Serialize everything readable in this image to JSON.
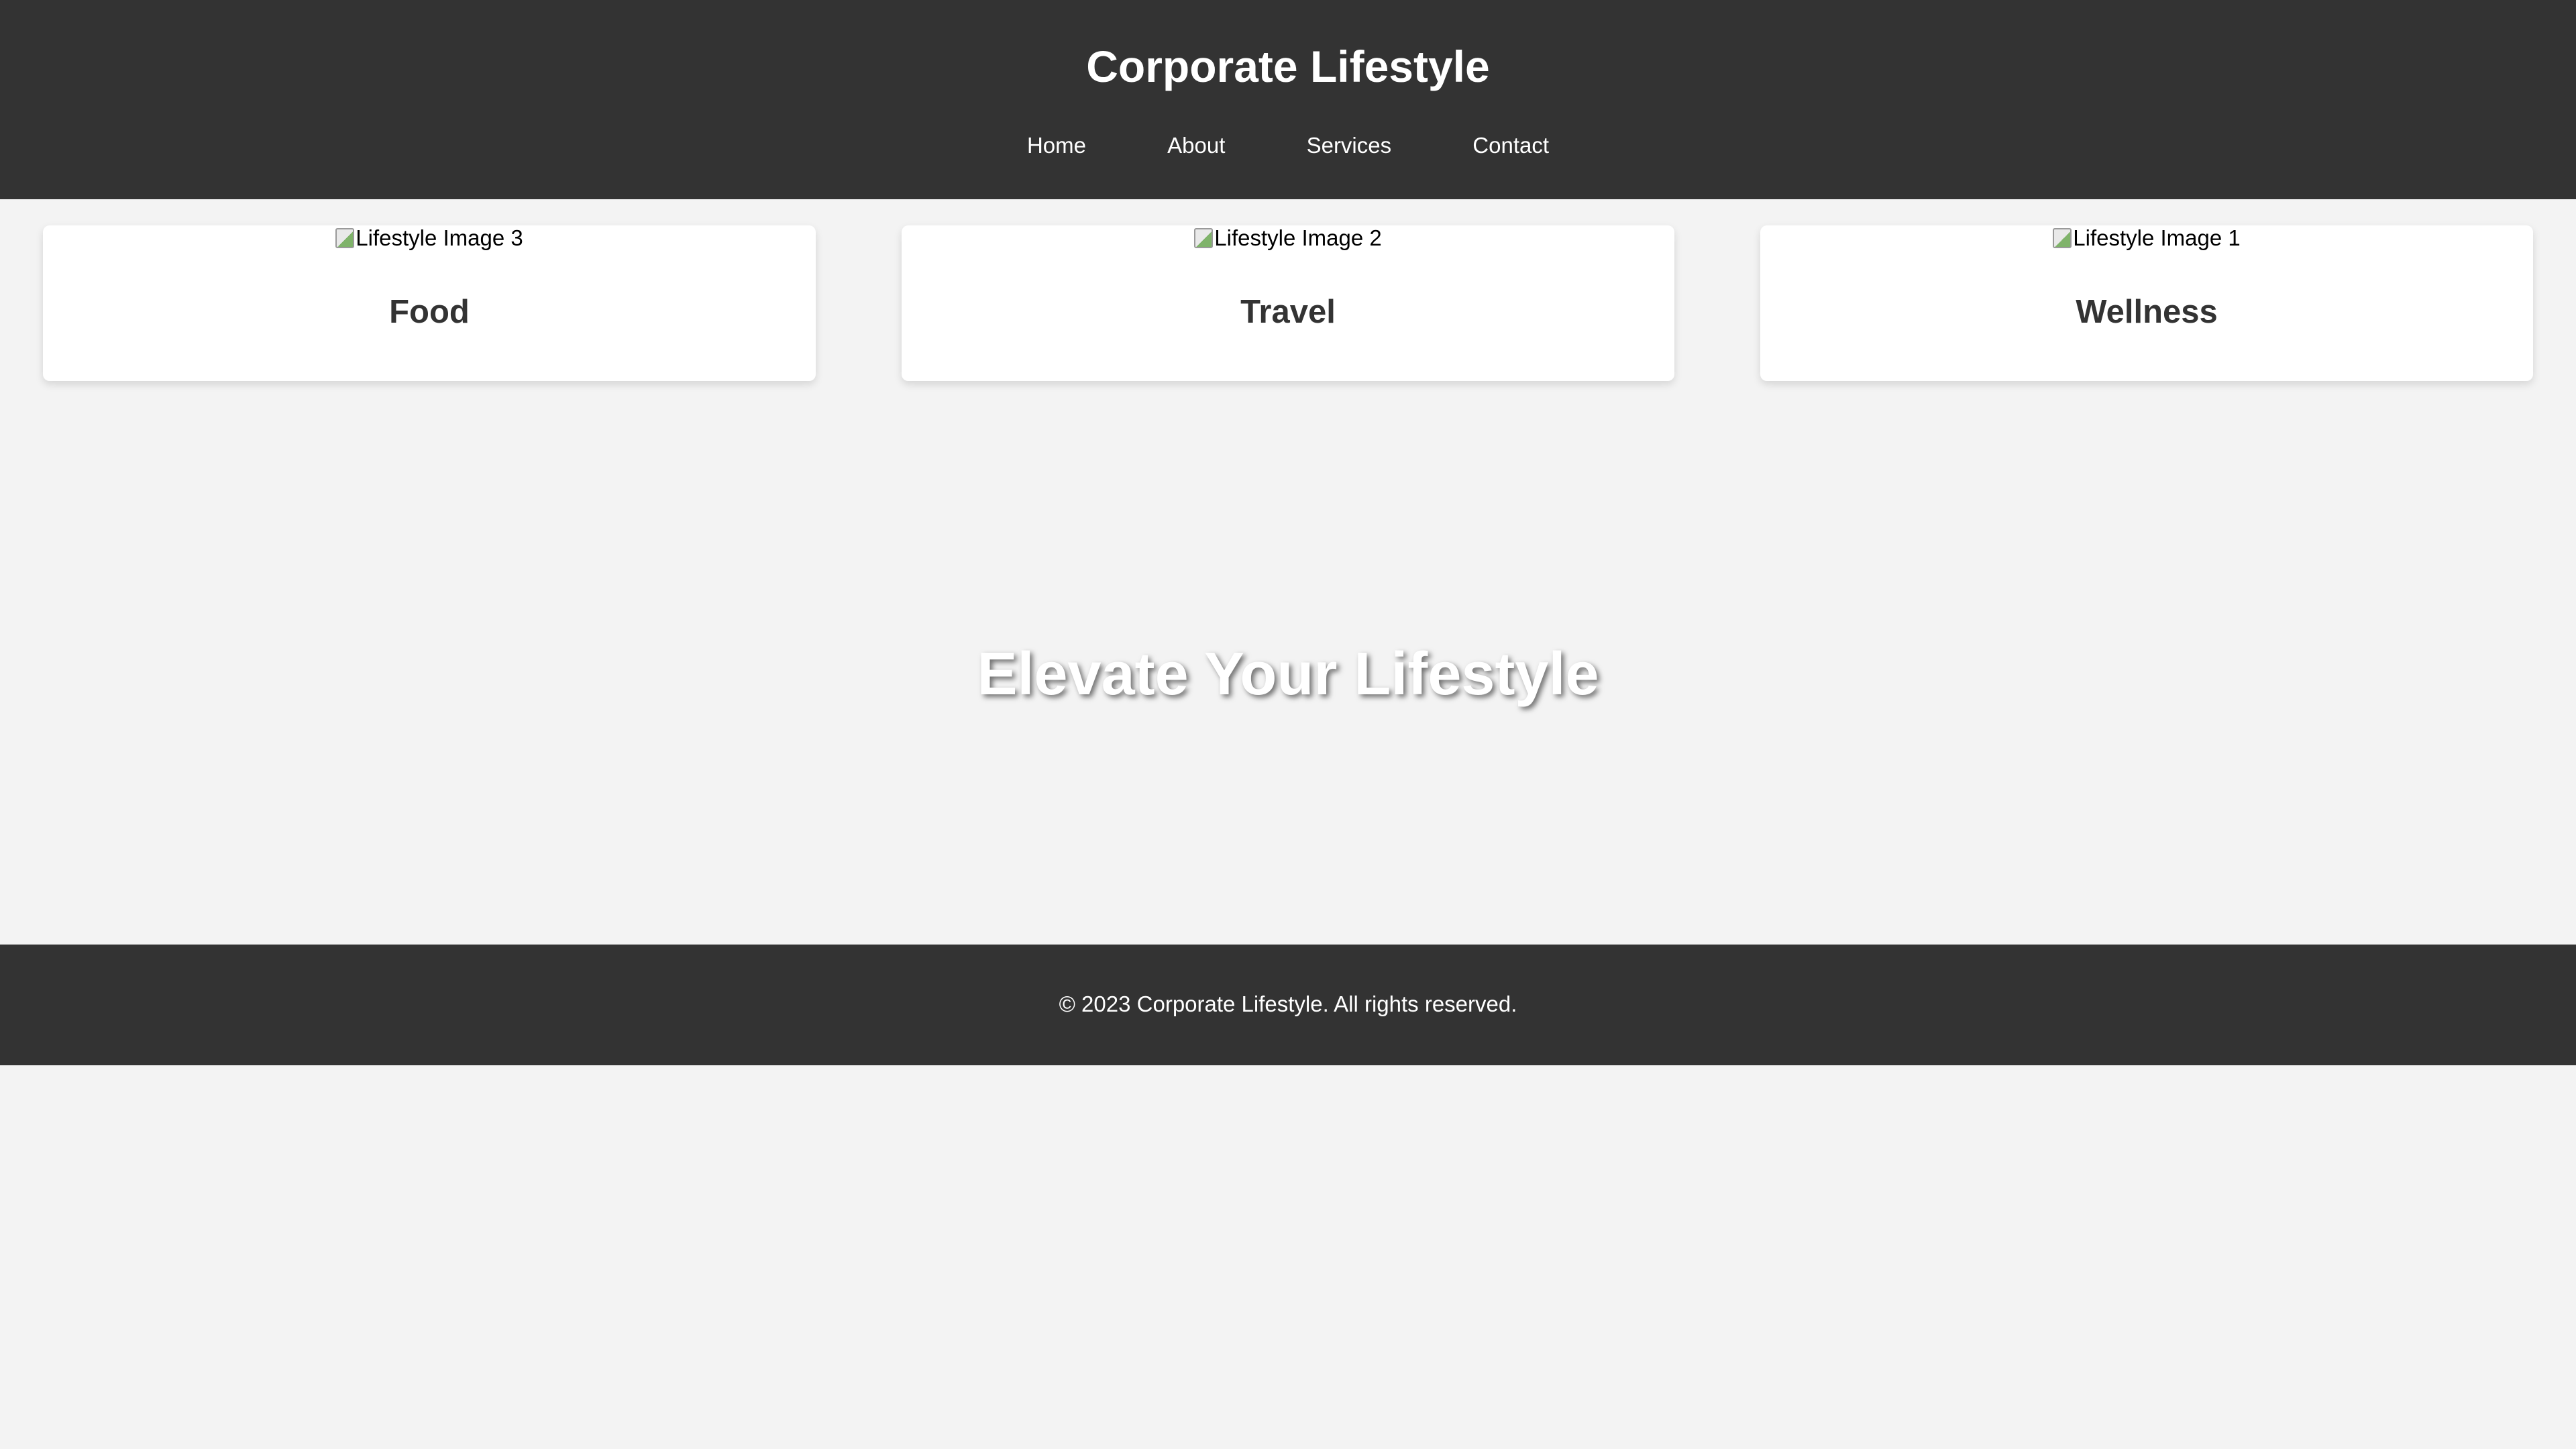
{
  "header": {
    "title": "Corporate Lifestyle",
    "nav": [
      {
        "label": "Home"
      },
      {
        "label": "About"
      },
      {
        "label": "Services"
      },
      {
        "label": "Contact"
      }
    ]
  },
  "cards": [
    {
      "image_alt": "Lifestyle Image 3",
      "title": "Food"
    },
    {
      "image_alt": "Lifestyle Image 2",
      "title": "Travel"
    },
    {
      "image_alt": "Lifestyle Image 1",
      "title": "Wellness"
    }
  ],
  "hero": {
    "text": "Elevate Your Lifestyle"
  },
  "footer": {
    "text": "© 2023 Corporate Lifestyle. All rights reserved."
  },
  "colors": {
    "header_bg": "#333333",
    "page_bg": "#f3f3f3",
    "card_bg": "#ffffff",
    "card_title": "#333333",
    "footer_bg": "#333333"
  }
}
